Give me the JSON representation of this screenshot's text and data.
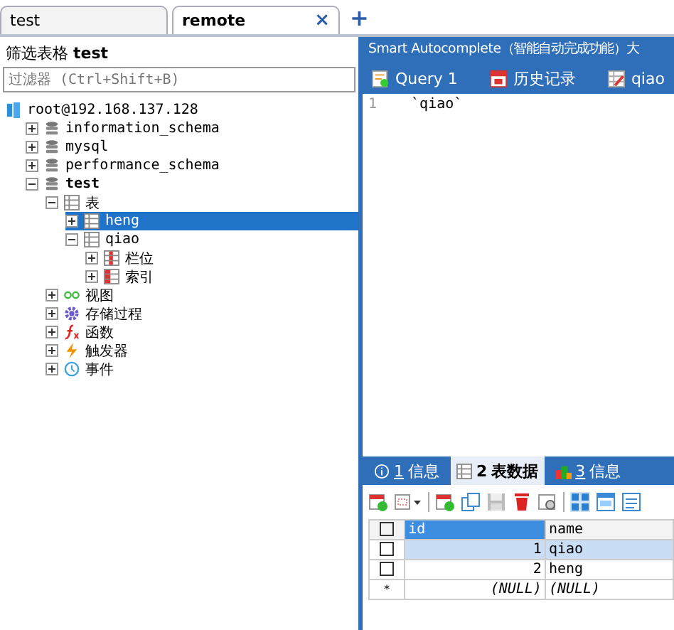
{
  "tabs": [
    {
      "label": "test",
      "selected": false
    },
    {
      "label": "remote",
      "selected": true,
      "close": "×"
    }
  ],
  "new_tab": "+",
  "filter": {
    "title": "筛选表格 **test**",
    "placeholder": "过滤器 (Ctrl+Shift+B)"
  },
  "tree": [
    {
      "label": "root@192.168.137.128",
      "kind": "server",
      "selected": false,
      "children": [
        {
          "label": "information_schema",
          "kind": "database",
          "expanded": false,
          "selected": false
        },
        {
          "label": "mysql",
          "kind": "database",
          "expanded": false,
          "selected": false
        },
        {
          "label": "performance_schema",
          "kind": "database",
          "expanded": false,
          "selected": false
        },
        {
          "label": "test",
          "kind": "database",
          "expanded": true,
          "selected": false,
          "bold": true,
          "children": [
            {
              "label": "表",
              "kind": "tables",
              "expanded": true,
              "selected": false,
              "children": [
                {
                  "label": "heng",
                  "kind": "table",
                  "expanded": false,
                  "selected": true
                },
                {
                  "label": "qiao",
                  "kind": "table",
                  "expanded": true,
                  "selected": false,
                  "children": [
                    {
                      "label": "栏位",
                      "kind": "columns",
                      "expanded": false,
                      "selected": false
                    },
                    {
                      "label": "索引",
                      "kind": "index",
                      "expanded": false,
                      "selected": false
                    }
                  ]
                }
              ]
            },
            {
              "label": "视图",
              "kind": "view",
              "expanded": false,
              "selected": false
            },
            {
              "label": "存储过程",
              "kind": "procedure",
              "expanded": false,
              "selected": false
            },
            {
              "label": "函数",
              "kind": "function",
              "expanded": false,
              "selected": false
            },
            {
              "label": "触发器",
              "kind": "trigger",
              "expanded": false,
              "selected": false
            },
            {
              "label": "事件",
              "kind": "event",
              "expanded": false,
              "selected": false
            }
          ]
        }
      ]
    }
  ],
  "header": "Smart Autocomplete（智能自动完成功能）大",
  "query_tabs": [
    {
      "label": "Query 1",
      "kind": "query"
    },
    {
      "label": "历史记录",
      "kind": "history"
    },
    {
      "label": "qiao",
      "kind": "table"
    }
  ],
  "editor": {
    "lines": [
      {
        "number": "1",
        "code": "`qiao`"
      }
    ]
  },
  "result_tabs": [
    {
      "key": "1",
      "label": "信息",
      "kind": "info",
      "selected": false
    },
    {
      "key": "2",
      "label": "表数据",
      "kind": "table",
      "selected": true
    },
    {
      "key": "3",
      "label": "信息",
      "kind": "chart",
      "selected": false
    }
  ],
  "grid": {
    "all_checked": false,
    "columns": [
      {
        "label": "id",
        "selected": true
      },
      {
        "label": "name",
        "selected": false
      }
    ],
    "rows": [
      {
        "kind": "data",
        "selected": true,
        "checked": false,
        "cells": [
          "1",
          "qiao"
        ]
      },
      {
        "kind": "data",
        "selected": false,
        "checked": false,
        "cells": [
          "2",
          "heng"
        ]
      },
      {
        "kind": "new",
        "marker": "*",
        "selected": false,
        "cells": [
          "(NULL)",
          "(NULL)"
        ]
      }
    ]
  }
}
